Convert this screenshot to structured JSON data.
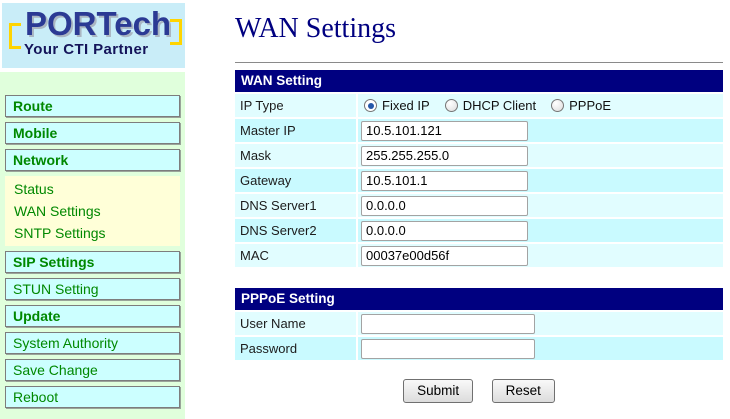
{
  "logo": {
    "brand": "PORTech",
    "tagline": "Your CTI Partner"
  },
  "sidebar": {
    "items": [
      {
        "kind": "category",
        "label": "Route"
      },
      {
        "kind": "category",
        "label": "Mobile"
      },
      {
        "kind": "category",
        "label": "Network",
        "submenu": [
          "Status",
          "WAN Settings",
          "SNTP Settings"
        ]
      },
      {
        "kind": "category",
        "label": "SIP Settings"
      },
      {
        "kind": "page",
        "label": "STUN Setting"
      },
      {
        "kind": "category",
        "label": "Update"
      },
      {
        "kind": "page",
        "label": "System Authority"
      },
      {
        "kind": "page",
        "label": "Save Change"
      },
      {
        "kind": "page",
        "label": "Reboot"
      }
    ]
  },
  "main": {
    "title": "WAN Settings",
    "wan": {
      "header": "WAN Setting",
      "rows": [
        {
          "type": "radio",
          "label": "IP Type",
          "options": [
            {
              "label": "Fixed IP",
              "selected": true
            },
            {
              "label": "DHCP Client",
              "selected": false
            },
            {
              "label": "PPPoE",
              "selected": false
            }
          ]
        },
        {
          "type": "text",
          "label": "Master IP",
          "value": "10.5.101.121"
        },
        {
          "type": "text",
          "label": "Mask",
          "value": "255.255.255.0"
        },
        {
          "type": "text",
          "label": "Gateway",
          "value": "10.5.101.1"
        },
        {
          "type": "text",
          "label": "DNS Server1",
          "value": "0.0.0.0"
        },
        {
          "type": "text",
          "label": "DNS Server2",
          "value": "0.0.0.0"
        },
        {
          "type": "text",
          "label": "MAC",
          "value": "00037e00d56f"
        }
      ]
    },
    "pppoe": {
      "header": "PPPoE Setting",
      "rows": [
        {
          "type": "text",
          "label": "User Name",
          "value": ""
        },
        {
          "type": "text",
          "label": "Password",
          "value": ""
        }
      ]
    },
    "buttons": {
      "submit": "Submit",
      "reset": "Reset"
    }
  },
  "colors": {
    "navy_header": "#000080",
    "title_navy": "#000080",
    "logo_bg": "#c9edf8",
    "logo_text": "#2b3a94",
    "logo_tagline": "#14145a",
    "logo_bracket_yellow": "#ffd400",
    "sidebar_bg": "#e0ffdc",
    "menu_btn_bg": "#ccffff",
    "menu_text_green": "#008800",
    "submenu_bg": "#ffffd8",
    "row_light": "#e1fdff",
    "row_dark": "#c9faff",
    "radio_dot_blue": "#2457a8"
  }
}
